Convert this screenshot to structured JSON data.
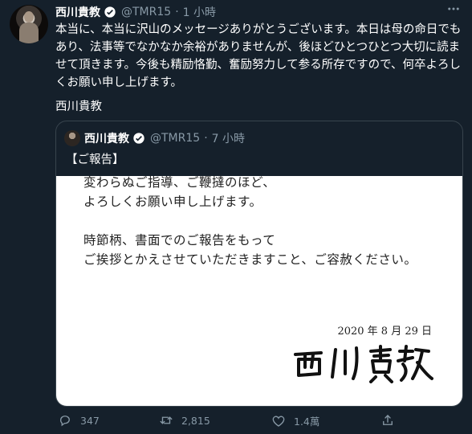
{
  "tweet": {
    "author_name": "西川貴教",
    "handle": "@TMR15",
    "separator": "·",
    "time": "1 小時",
    "text": "本当に、本当に沢山のメッセージありがとうございます。本日は母の命日でもあり、法事等でなかなか余裕がありませんが、後ほどひとつひとつ大切に読ませて頂きます。今後も精励恪勤、奮励努力して参る所存ですので、何卒よろしくお願い申し上げます。",
    "signature": "西川貴教"
  },
  "quoted": {
    "author_name": "西川貴教",
    "handle": "@TMR15",
    "separator": "·",
    "time": "7 小時",
    "title": "【ご報告】",
    "doc_lines": [
      "変わらぬご指導、ご鞭撻のほど、",
      "よろしくお願い申し上げます。",
      "時節柄、書面でのご報告をもって",
      "ご挨拶とかえさせていただきますこと、ご容赦ください。"
    ],
    "doc_date": "2020 年 8 月 29 日",
    "doc_signature": "西川貴教"
  },
  "actions": {
    "reply_count": "347",
    "retweet_count": "2,815",
    "like_count": "1.4萬"
  },
  "colors": {
    "background": "#15202b",
    "secondary": "#8899a6",
    "verified": "#1da1f2",
    "border": "#38444d"
  }
}
